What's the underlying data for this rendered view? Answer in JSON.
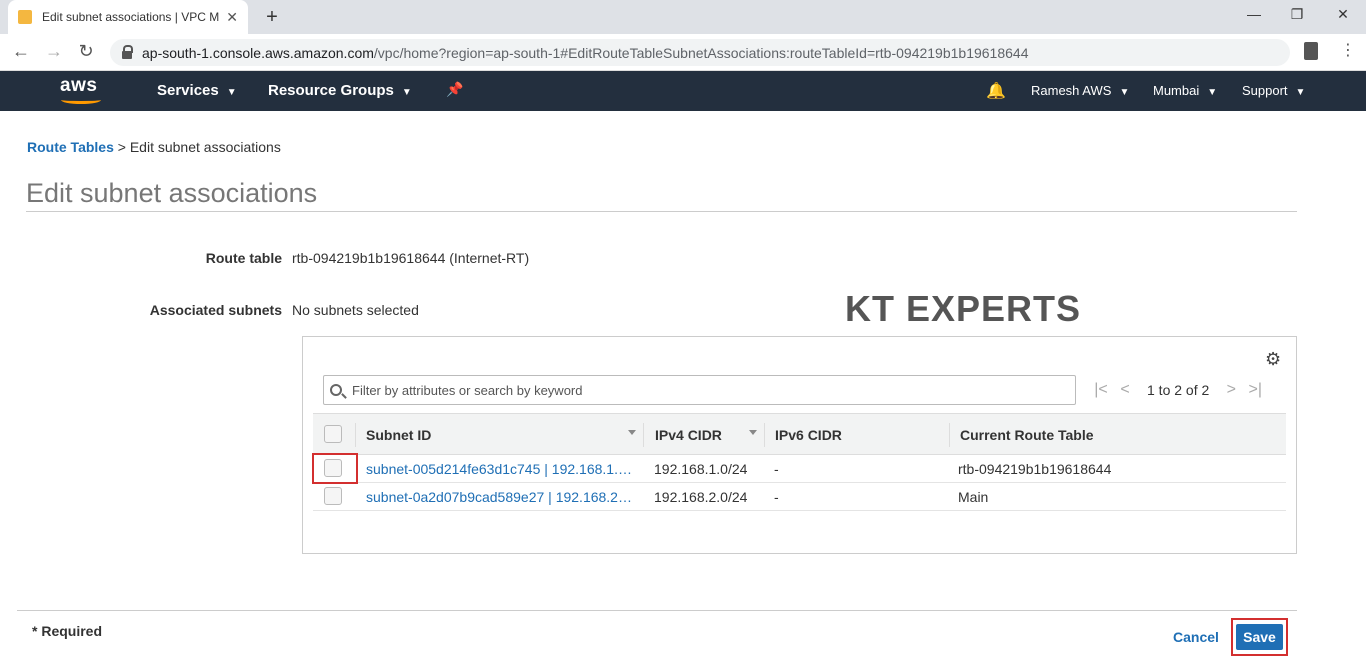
{
  "browser": {
    "tab_title": "Edit subnet associations | VPC M",
    "new_tab": "+",
    "close_tab": "✕",
    "url_host": "ap-south-1.console.aws.amazon.com",
    "url_path": "/vpc/home?region=ap-south-1#EditRouteTableSubnetAssociations:routeTableId=rtb-094219b1b19618644",
    "win_min": "—",
    "win_max": "❐",
    "win_close": "✕"
  },
  "header": {
    "logo": "aws",
    "services": "Services",
    "resource_groups": "Resource Groups",
    "user": "Ramesh AWS",
    "region": "Mumbai",
    "support": "Support"
  },
  "breadcrumb": {
    "link": "Route Tables",
    "separator": ">",
    "current": "Edit subnet associations"
  },
  "page_title": "Edit subnet associations",
  "form": {
    "route_table_label": "Route table",
    "route_table_value": "rtb-094219b1b19618644 (Internet-RT)",
    "associated_label": "Associated subnets",
    "associated_value": "No subnets selected"
  },
  "watermark": "KT EXPERTS",
  "table": {
    "search_placeholder": "Filter by attributes or search by keyword",
    "pager_text": "1 to 2 of 2",
    "columns": [
      "Subnet ID",
      "IPv4 CIDR",
      "IPv6 CIDR",
      "Current Route Table"
    ],
    "rows": [
      {
        "subnet": "subnet-005d214fe63d1c745 | 192.168.1.…",
        "ipv4": "192.168.1.0/24",
        "ipv6": "-",
        "route_table": "rtb-094219b1b19618644"
      },
      {
        "subnet": "subnet-0a2d07b9cad589e27 | 192.168.2…",
        "ipv4": "192.168.2.0/24",
        "ipv6": "-",
        "route_table": "Main"
      }
    ]
  },
  "footer": {
    "required": "* Required",
    "cancel": "Cancel",
    "save": "Save"
  },
  "colors": {
    "aws_header": "#232f3e",
    "aws_orange": "#ff9900",
    "link_blue": "#1f6fb5",
    "highlight_red": "#d32f2f"
  }
}
